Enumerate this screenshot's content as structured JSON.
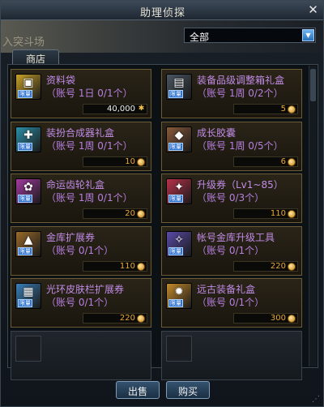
{
  "window": {
    "title": "助理侦探",
    "close_glyph": "✕"
  },
  "background": {
    "text": "入突斗场"
  },
  "filter": {
    "selected": "全部",
    "arrow_glyph": "▼"
  },
  "tabs": [
    {
      "label": "商店"
    }
  ],
  "items": [
    {
      "name": "资料袋",
      "limit": "（账号 1日 0/1个）",
      "price": "40,000",
      "currency": "gold",
      "icon": "gold-box-icon",
      "icon_color": "#c9a227",
      "badge": "限量"
    },
    {
      "name": "装备品级调整箱礼盒",
      "limit": "（账号 1周 0/2个）",
      "price": "5",
      "currency": "coin",
      "icon": "equipment-chest-icon",
      "icon_color": "#4a5662",
      "badge": "限量"
    },
    {
      "name": "装扮合成器礼盒",
      "limit": "（账号 1周 0/1个）",
      "price": "10",
      "currency": "coin",
      "icon": "synthesizer-box-icon",
      "icon_color": "#2b8fa8",
      "badge": "限量"
    },
    {
      "name": "成长胶囊",
      "limit": "（账号 1周 0/5个）",
      "price": "6",
      "currency": "coin",
      "icon": "growth-capsule-icon",
      "icon_color": "#8a5a3a",
      "badge": "限量"
    },
    {
      "name": "命运齿轮礼盒",
      "limit": "（账号 1周 0/1个）",
      "price": "20",
      "currency": "coin",
      "icon": "fate-gear-box-icon",
      "icon_color": "#a33aa0",
      "badge": "限量"
    },
    {
      "name": "升级券（Lv1~85）",
      "limit": "（账号 0/3个）",
      "price": "110",
      "currency": "coin",
      "icon": "level-ticket-icon",
      "icon_color": "#b8324a",
      "badge": "限量"
    },
    {
      "name": "金库扩展券",
      "limit": "（账号 0/1个）",
      "price": "110",
      "currency": "coin",
      "icon": "vault-expand-icon",
      "icon_color": "#9a6a2a",
      "badge": "限量"
    },
    {
      "name": "帐号金库升级工具",
      "limit": "（账号 0/1个）",
      "price": "220",
      "currency": "coin",
      "icon": "account-vault-tool-icon",
      "icon_color": "#5a4aa8",
      "badge": "限量"
    },
    {
      "name": "光环皮肤栏扩展券",
      "limit": "（账号 0/1个）",
      "price": "220",
      "currency": "coin",
      "icon": "aura-skin-slot-icon",
      "icon_color": "#3a7fb8",
      "badge": "限量"
    },
    {
      "name": "远古装备礼盒",
      "limit": "（账号 0/1个）",
      "price": "300",
      "currency": "coin",
      "icon": "ancient-equipment-box-icon",
      "icon_color": "#c48a2a",
      "badge": "限量"
    }
  ],
  "buttons": {
    "sell": "出售",
    "buy": "购买"
  },
  "colors": {
    "item_name": "#c18ce6",
    "price": "#e9a832",
    "frame_gold": "#6c5c34",
    "accent_blue": "#2a6fb8"
  }
}
